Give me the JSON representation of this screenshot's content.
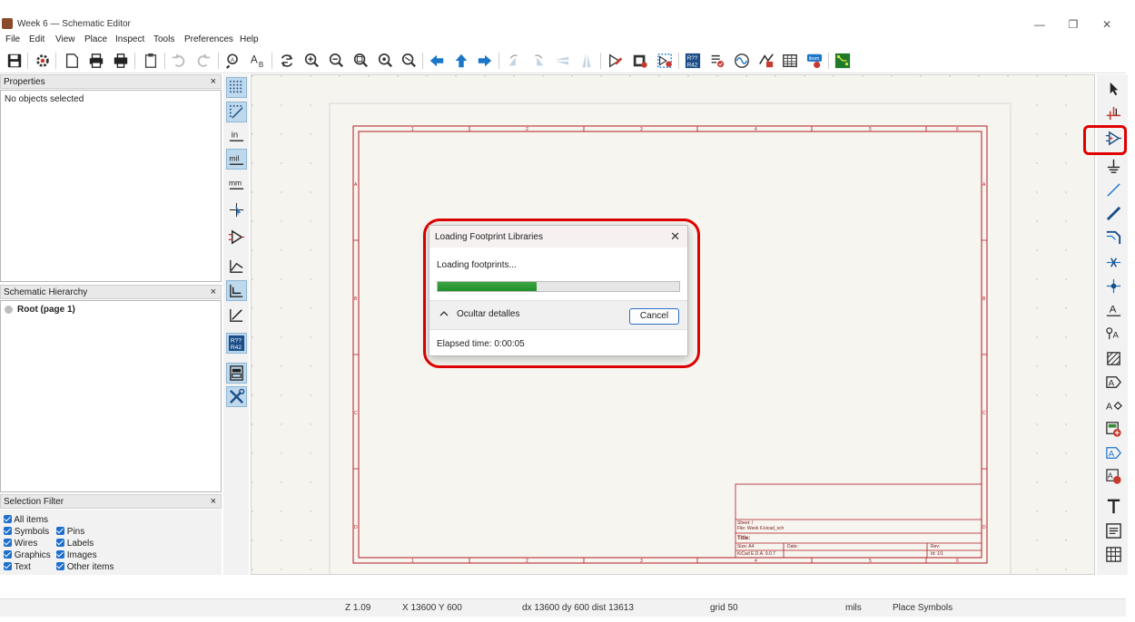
{
  "window": {
    "title": "Week 6 — Schematic Editor",
    "minimize": "—",
    "restore": "❐",
    "close": "✕"
  },
  "menu": [
    "File",
    "Edit",
    "View",
    "Place",
    "Inspect",
    "Tools",
    "Preferences",
    "Help"
  ],
  "properties_panel": {
    "title": "Properties",
    "close": "×",
    "content": "No objects selected"
  },
  "hierarchy_panel": {
    "title": "Schematic Hierarchy",
    "close": "×",
    "root": "Root (page 1)"
  },
  "selection_filter": {
    "title": "Selection Filter",
    "close": "×",
    "items": [
      "All items",
      "Symbols",
      "Pins",
      "Wires",
      "Labels",
      "Graphics",
      "Images",
      "Text",
      "Other items"
    ]
  },
  "left_toolbar": {
    "units_in": "in",
    "units_mil": "mil",
    "units_mm": "mm",
    "annotate_top": "R??",
    "annotate_bottom": "R42"
  },
  "main_toolbar": {
    "annotate_top": "R??",
    "annotate_bottom": "R42",
    "browse_label": "ibom"
  },
  "title_block": {
    "sheet": "Sheet: /",
    "file": "File: Week 6.kicad_sch",
    "title_label": "Title:",
    "size": "Size: A4",
    "date": "Date:",
    "rev": "Rev:",
    "tool": "KiCad E.D.A. 9.0.7",
    "id": "Id: 1/1"
  },
  "frame_labels": {
    "cols": [
      "1",
      "2",
      "3",
      "4",
      "5",
      "6"
    ],
    "rows": [
      "A",
      "B",
      "C",
      "D"
    ]
  },
  "dialog": {
    "title": "Loading Footprint Libraries",
    "close": "✕",
    "message": "Loading footprints...",
    "progress": 0.41,
    "details_toggle": "Ocultar detalles",
    "cancel": "Cancel",
    "elapsed": "Elapsed time: 0:00:05"
  },
  "status": {
    "zoom": "Z 1.09",
    "coords": "X 13600  Y 600",
    "delta": "dx 13600  dy 600  dist 13613",
    "grid": "grid 50",
    "units": "mils",
    "mode": "Place Symbols"
  },
  "colors": {
    "frame": "#b11a22",
    "highlight": "#e00000",
    "progress": "#1f8f2b",
    "canvas_bg": "#f5f4ef",
    "tool_blue": "#1b76c9"
  }
}
